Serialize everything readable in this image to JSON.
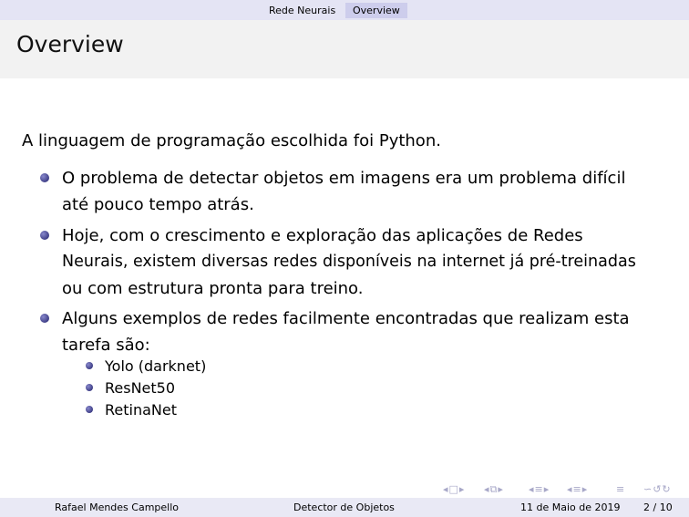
{
  "nav": {
    "section": "Rede Neurais",
    "subsection": "Overview"
  },
  "slide": {
    "title": "Overview",
    "intro": "A linguagem de programação escolhida foi Python.",
    "items": [
      {
        "line1": "O problema de detectar objetos em imagens era um problema difícil",
        "line2": "até pouco tempo atrás."
      },
      {
        "line1": "Hoje, com o crescimento e exploração das aplicações de Redes",
        "line2": "Neurais, existem diversas redes disponíveis na internet já pré-treinadas",
        "line3": "ou com estrutura pronta para treino."
      },
      {
        "line1": "Alguns exemplos de redes facilmente encontradas que realizam esta",
        "line2": "tarefa são:"
      }
    ],
    "subitems": [
      "Yolo (darknet)",
      "ResNet50",
      "RetinaNet"
    ]
  },
  "footer": {
    "author": "Rafael Mendes Campello",
    "title": "Detector de Objetos",
    "date": "11 de Maio de 2019",
    "page": "2 / 10"
  },
  "colors": {
    "nav_bg": "#e4e4f4",
    "nav_active": "#cdcdec",
    "footer_left": "#2e2e8a",
    "footer_mid": "#4848b0",
    "footer_right": "#6a6ad0"
  }
}
